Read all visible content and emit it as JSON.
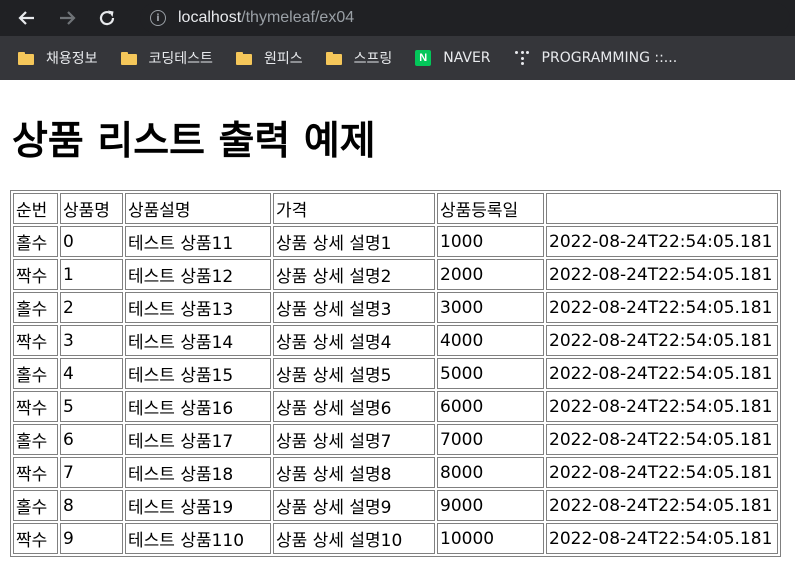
{
  "browser": {
    "url_host": "localhost",
    "url_path": "/thymeleaf/ex04",
    "bookmarks": [
      {
        "label": "채용정보",
        "icon": "folder-icon"
      },
      {
        "label": "코딩테스트",
        "icon": "folder-icon"
      },
      {
        "label": "원피스",
        "icon": "folder-icon"
      },
      {
        "label": "스프링",
        "icon": "folder-icon"
      },
      {
        "label": "NAVER",
        "icon": "naver-icon"
      },
      {
        "label": "PROGRAMMING ::...",
        "icon": "dots-icon"
      }
    ]
  },
  "page": {
    "title": "상품 리스트 출력 예제",
    "table": {
      "headers": [
        "순번",
        "상품명",
        "상품설명",
        "가격",
        "상품등록일",
        ""
      ],
      "rows": [
        [
          "홀수",
          "0",
          "테스트 상품11",
          "상품 상세 설명1",
          "1000",
          "2022-08-24T22:54:05.181"
        ],
        [
          "짝수",
          "1",
          "테스트 상품12",
          "상품 상세 설명2",
          "2000",
          "2022-08-24T22:54:05.181"
        ],
        [
          "홀수",
          "2",
          "테스트 상품13",
          "상품 상세 설명3",
          "3000",
          "2022-08-24T22:54:05.181"
        ],
        [
          "짝수",
          "3",
          "테스트 상품14",
          "상품 상세 설명4",
          "4000",
          "2022-08-24T22:54:05.181"
        ],
        [
          "홀수",
          "4",
          "테스트 상품15",
          "상품 상세 설명5",
          "5000",
          "2022-08-24T22:54:05.181"
        ],
        [
          "짝수",
          "5",
          "테스트 상품16",
          "상품 상세 설명6",
          "6000",
          "2022-08-24T22:54:05.181"
        ],
        [
          "홀수",
          "6",
          "테스트 상품17",
          "상품 상세 설명7",
          "7000",
          "2022-08-24T22:54:05.181"
        ],
        [
          "짝수",
          "7",
          "테스트 상품18",
          "상품 상세 설명8",
          "8000",
          "2022-08-24T22:54:05.181"
        ],
        [
          "홀수",
          "8",
          "테스트 상품19",
          "상품 상세 설명9",
          "9000",
          "2022-08-24T22:54:05.181"
        ],
        [
          "짝수",
          "9",
          "테스트 상품110",
          "상품 상세 설명10",
          "10000",
          "2022-08-24T22:54:05.181"
        ]
      ]
    }
  }
}
